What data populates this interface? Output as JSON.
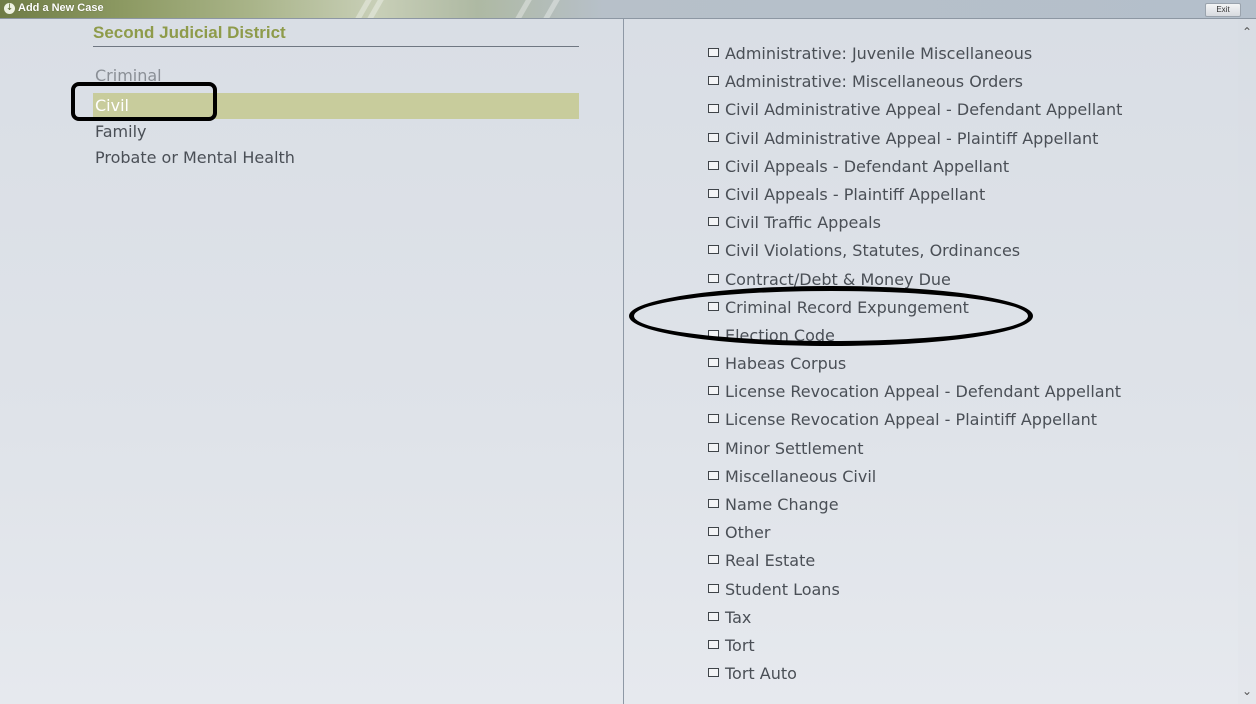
{
  "window": {
    "title": "Add a New Case",
    "exit_label": "Exit",
    "title_icon": "info-icon"
  },
  "left": {
    "district": "Second Judicial District",
    "categories": [
      {
        "label": "Criminal",
        "state": "partially-hidden"
      },
      {
        "label": "Civil",
        "state": "selected"
      },
      {
        "label": "Family",
        "state": "normal"
      },
      {
        "label": "Probate or Mental Health",
        "state": "normal"
      }
    ]
  },
  "right": {
    "case_types": [
      "Administrative: Juvenile Miscellaneous",
      "Administrative: Miscellaneous Orders",
      "Civil Administrative Appeal - Defendant Appellant",
      "Civil Administrative Appeal - Plaintiff Appellant",
      "Civil Appeals - Defendant Appellant",
      "Civil Appeals - Plaintiff Appellant",
      "Civil Traffic Appeals",
      "Civil Violations, Statutes, Ordinances",
      "Contract/Debt & Money Due",
      "Criminal Record Expungement",
      "Election Code",
      "Habeas Corpus",
      "License Revocation Appeal - Defendant Appellant",
      "License Revocation Appeal - Plaintiff Appellant",
      "Minor Settlement",
      "Miscellaneous Civil",
      "Name Change",
      "Other",
      "Real Estate",
      "Student Loans",
      "Tax",
      "Tort",
      "Tort Auto"
    ]
  },
  "colors": {
    "accent_green": "#8e9b4a",
    "selected_bg": "#c8cc9c",
    "panel_bg": "#dfe3e9",
    "text": "#4a4f56"
  },
  "annotations": {
    "rectangle_target": "Civil",
    "ellipse_target": "Criminal Record Expungement"
  }
}
